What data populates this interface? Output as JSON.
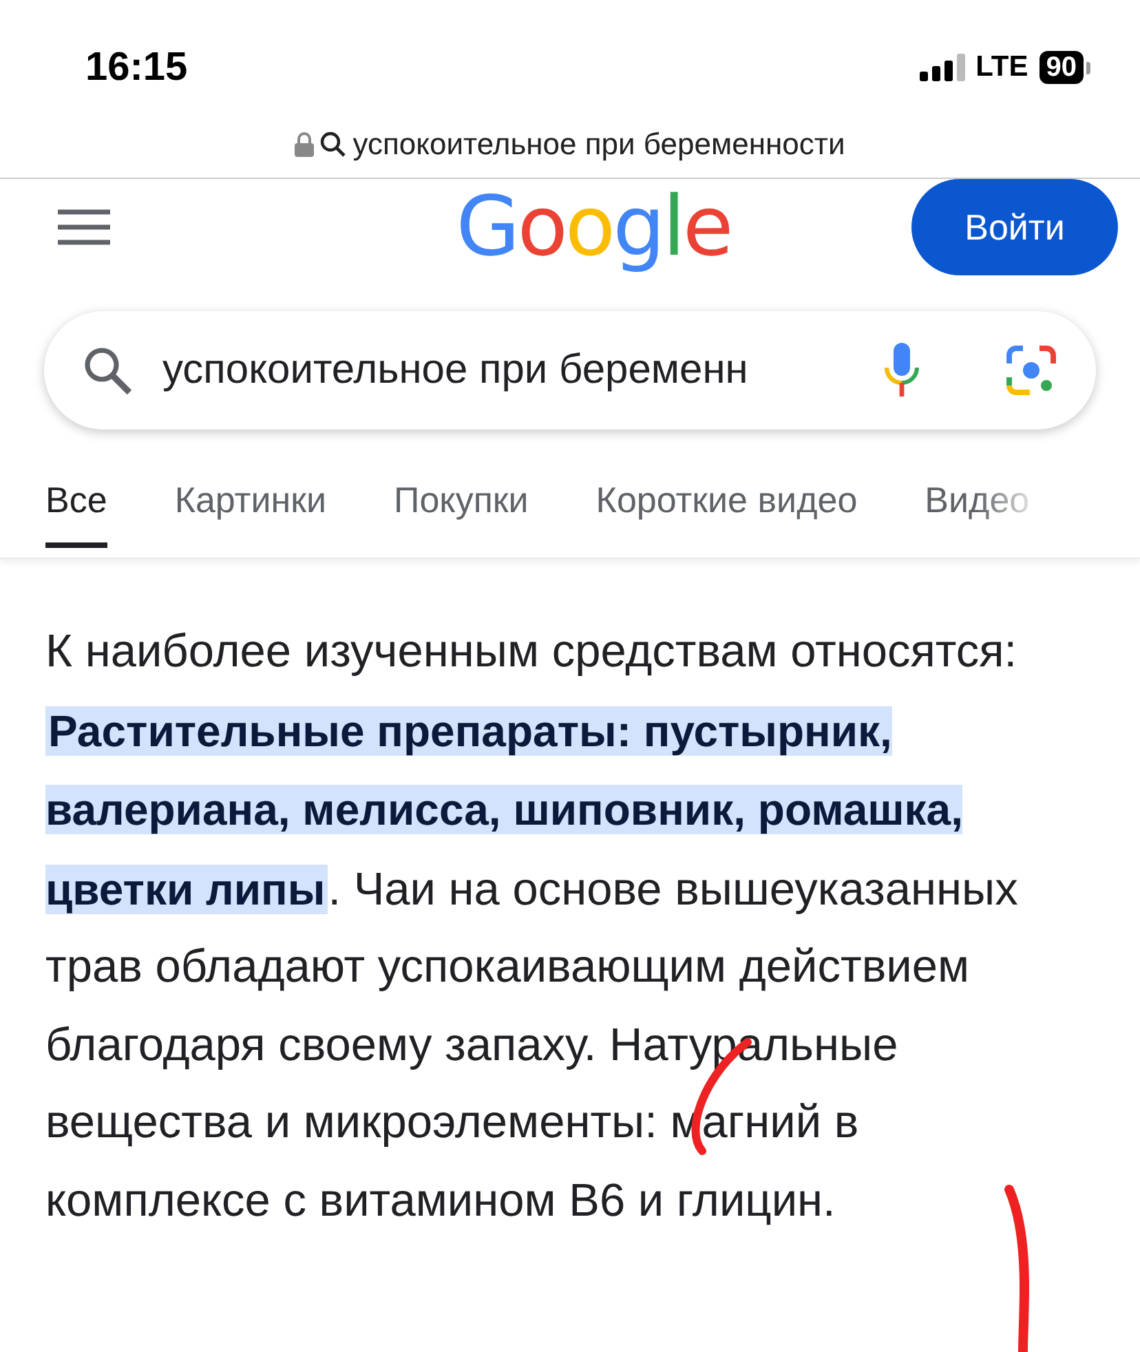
{
  "status_bar": {
    "time": "16:15",
    "network": "LTE",
    "battery": "90"
  },
  "url_bar": {
    "address": "успокоительное при беременности"
  },
  "header": {
    "logo": "Google",
    "sign_in": "Войти"
  },
  "search": {
    "value": "успокоительное при беременн"
  },
  "tabs": [
    {
      "label": "Все",
      "selected": true
    },
    {
      "label": "Картинки",
      "selected": false
    },
    {
      "label": "Покупки",
      "selected": false
    },
    {
      "label": "Короткие видео",
      "selected": false
    },
    {
      "label": "Видео",
      "selected": false
    }
  ],
  "answer": {
    "text": "К наиболее изученным средствам относятся: **Растительные препараты: пустырник, валериана, мелисса, шиповник, ромашка, цветки липы**. Чаи на основе вышеуказанных трав обладают успокаивающим действием благодаря своему запаху. Натуральные вещества и микроэлементы: магний в комплексе с витамином В6 и глицин."
  }
}
